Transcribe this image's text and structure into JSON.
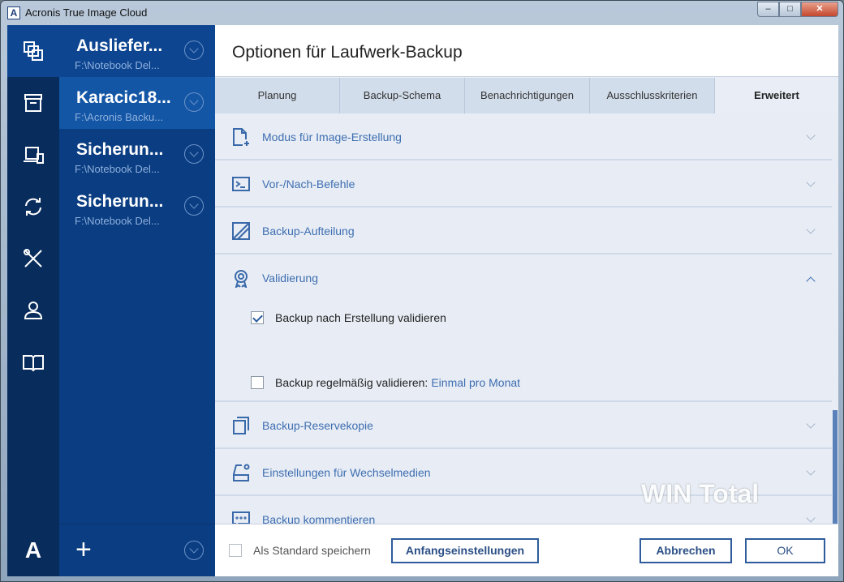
{
  "window": {
    "title": "Acronis True Image Cloud",
    "app_icon": "A",
    "minimize": "‒",
    "maximize": "□",
    "close": "✕"
  },
  "rail": {
    "items": [
      "copy-icon",
      "archive-icon",
      "devices-icon",
      "sync-icon",
      "tools-icon",
      "account-icon",
      "book-icon"
    ],
    "logo": "A"
  },
  "backups": [
    {
      "name": "Ausliefer...",
      "path": "F:\\Notebook Del..."
    },
    {
      "name": "Karacic18...",
      "path": "F:\\Acronis Backu..."
    },
    {
      "name": "Sicherun...",
      "path": "F:\\Notebook Del..."
    },
    {
      "name": "Sicherun...",
      "path": "F:\\Notebook Del..."
    }
  ],
  "list_footer": {
    "add": "+"
  },
  "header": {
    "title": "Optionen für Laufwerk-Backup"
  },
  "tabs": [
    "Planung",
    "Backup-Schema",
    "Benachrichtigungen",
    "Ausschlusskriterien",
    "Erweitert"
  ],
  "sections": [
    "Modus für Image-Erstellung",
    "Vor-/Nach-Befehle",
    "Backup-Aufteilung",
    "Validierung",
    "Backup-Reservekopie",
    "Einstellungen für Wechselmedien",
    "Backup kommentieren"
  ],
  "validation": {
    "opt1": "Backup nach Erstellung validieren",
    "opt1_checked": true,
    "opt2": "Backup regelmäßig validieren:",
    "opt2_checked": false,
    "opt2_link": "Einmal pro Monat"
  },
  "footer": {
    "save_default": "Als Standard speichern",
    "reset": "Anfangseinstellungen",
    "cancel": "Abbrechen",
    "ok": "OK"
  },
  "watermark": "WIN Total"
}
